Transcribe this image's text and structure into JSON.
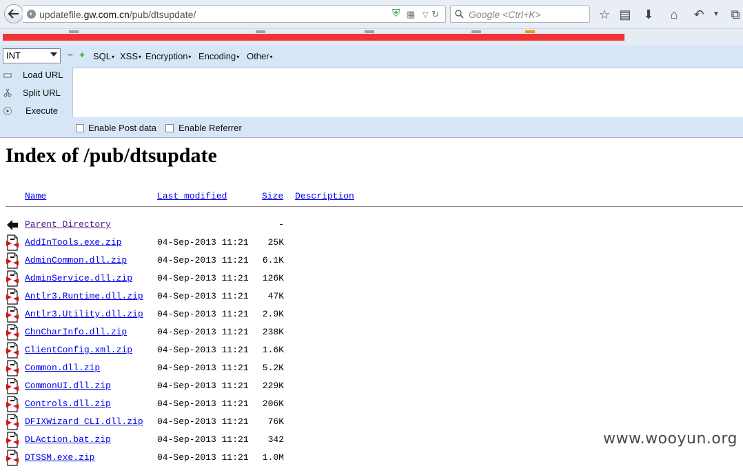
{
  "browser": {
    "url_prefix": "updatefile.",
    "url_host": "gw.com.cn",
    "url_path": "/pub/dtsupdate/",
    "search_placeholder": "Google <Ctrl+K>"
  },
  "hackbar": {
    "type_select": "INT",
    "menus": [
      "SQL",
      "XSS",
      "Encryption",
      "Encoding",
      "Other"
    ],
    "actions": [
      {
        "label": "Load URL"
      },
      {
        "label": "Split URL"
      },
      {
        "label": "Execute"
      }
    ],
    "enable_post": "Enable Post data",
    "enable_referrer": "Enable Referrer"
  },
  "page": {
    "title": "Index of /pub/dtsupdate",
    "columns": {
      "name": "Name",
      "modified": "Last modified",
      "size": "Size",
      "description": "Description"
    },
    "parent": {
      "name": "Parent Directory",
      "size": "-"
    },
    "files": [
      {
        "name": "AddInTools.exe.zip",
        "modified": "04-Sep-2013 11:21",
        "size": "25K"
      },
      {
        "name": "AdminCommon.dll.zip",
        "modified": "04-Sep-2013 11:21",
        "size": "6.1K"
      },
      {
        "name": "AdminService.dll.zip",
        "modified": "04-Sep-2013 11:21",
        "size": "126K"
      },
      {
        "name": "Antlr3.Runtime.dll.zip",
        "modified": "04-Sep-2013 11:21",
        "size": "47K"
      },
      {
        "name": "Antlr3.Utility.dll.zip",
        "modified": "04-Sep-2013 11:21",
        "size": "2.9K"
      },
      {
        "name": "ChnCharInfo.dll.zip",
        "modified": "04-Sep-2013 11:21",
        "size": "238K"
      },
      {
        "name": "ClientConfig.xml.zip",
        "modified": "04-Sep-2013 11:21",
        "size": "1.6K"
      },
      {
        "name": "Common.dll.zip",
        "modified": "04-Sep-2013 11:21",
        "size": "5.2K"
      },
      {
        "name": "CommonUI.dll.zip",
        "modified": "04-Sep-2013 11:21",
        "size": "229K"
      },
      {
        "name": "Controls.dll.zip",
        "modified": "04-Sep-2013 11:21",
        "size": "206K"
      },
      {
        "name": "DFIXWizard CLI.dll.zip",
        "modified": "04-Sep-2013 11:21",
        "size": "76K"
      },
      {
        "name": "DLAction.bat.zip",
        "modified": "04-Sep-2013 11:21",
        "size": "342"
      },
      {
        "name": "DTSSM.exe.zip",
        "modified": "04-Sep-2013 11:21",
        "size": "1.0M"
      }
    ]
  },
  "watermark": "www.wooyun.org"
}
